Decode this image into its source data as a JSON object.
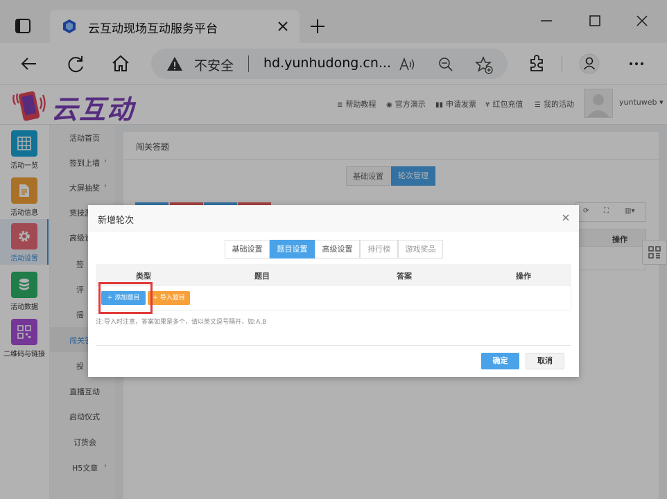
{
  "browser": {
    "tab_title": "云互动现场互动服务平台",
    "security_label": "不安全",
    "url": "hd.yunhudong.cn...",
    "icons": [
      "tab-actions-icon",
      "site-favicon",
      "close-icon",
      "plus-icon",
      "minimize-icon",
      "maximize-icon",
      "back-icon",
      "refresh-icon",
      "home-icon",
      "warning-icon",
      "read-aloud-icon",
      "zoom-out-icon",
      "favorite-icon",
      "extensions-icon",
      "profile-icon",
      "more-icon"
    ]
  },
  "site": {
    "logo_text": "云互动",
    "nav": [
      {
        "icon": "≣",
        "label": "帮助教程"
      },
      {
        "icon": "◉",
        "label": "官方演示"
      },
      {
        "icon": "▮▮",
        "label": "申请发票"
      },
      {
        "icon": "¥",
        "label": "红包充值"
      },
      {
        "icon": "☰",
        "label": "我的活动"
      }
    ],
    "username": "yuntuweb",
    "user_caret": "▾"
  },
  "icon_sidebar": [
    {
      "label": "活动一览",
      "color": "#1aa5d8",
      "icon": "grid-icon"
    },
    {
      "label": "活动信息",
      "color": "#f3a33a",
      "icon": "document-icon"
    },
    {
      "label": "活动设置",
      "color": "#e86a78",
      "icon": "gear-icon",
      "active": true
    },
    {
      "label": "活动数据",
      "color": "#2fb36b",
      "icon": "database-icon"
    },
    {
      "label": "二维码与链接",
      "color": "#a64fd8",
      "icon": "qrcode-icon"
    }
  ],
  "sub_sidebar": [
    {
      "label": "活动首页",
      "arrow": ""
    },
    {
      "label": "签到上墙",
      "arrow": "›"
    },
    {
      "label": "大屏抽奖",
      "arrow": "›"
    },
    {
      "label": "竞技游",
      "arrow": ""
    },
    {
      "label": "高级设",
      "arrow": ""
    },
    {
      "label": "签",
      "arrow": ""
    },
    {
      "label": "评",
      "arrow": ""
    },
    {
      "label": "摇",
      "arrow": ""
    },
    {
      "label": "闯关答",
      "arrow": "",
      "active": true
    },
    {
      "label": "投",
      "arrow": ""
    },
    {
      "label": "直播互动",
      "arrow": ""
    },
    {
      "label": "启动仪式",
      "arrow": ""
    },
    {
      "label": "订货会",
      "arrow": ""
    },
    {
      "label": "H5文章",
      "arrow": "›"
    }
  ],
  "content": {
    "title": "闯关答题",
    "tabs": [
      "基础设置",
      "轮次管理"
    ],
    "table_header_action": "操作",
    "toolbar_buttons_colors": [
      "#4aa3e8",
      "#e86060",
      "#4aa3e8",
      "#e86060"
    ]
  },
  "modal": {
    "title": "新增轮次",
    "tabs": [
      {
        "label": "基础设置",
        "state": "normal"
      },
      {
        "label": "题目设置",
        "state": "active"
      },
      {
        "label": "高级设置",
        "state": "normal"
      },
      {
        "label": "排行榜",
        "state": "disabled"
      },
      {
        "label": "游戏奖品",
        "state": "disabled"
      }
    ],
    "columns": [
      "类型",
      "题目",
      "答案",
      "操作"
    ],
    "add_button": "+ 添加题目",
    "import_button": "+ 导入题目",
    "note": "注:导入时注意，答案如果是多个，请以英文逗号隔开，如:A,B",
    "ok_button": "确定",
    "cancel_button": "取消"
  },
  "colors": {
    "accent": "#4aa3e8",
    "warning": "#f7a13a",
    "highlight": "#e03a3a",
    "logo": "#7b3fb7"
  }
}
